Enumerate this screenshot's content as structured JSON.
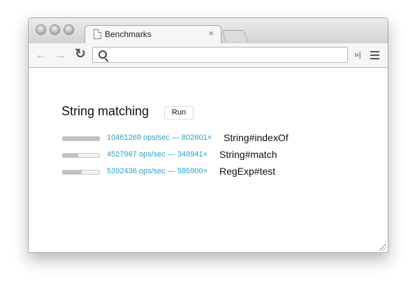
{
  "window": {
    "tab": {
      "title": "Benchmarks",
      "close": "×"
    },
    "toolbar": {
      "back": "←",
      "forward": "→",
      "reload": "↻",
      "address": {
        "value": "",
        "placeholder": ""
      },
      "extensions_chevron": "»|"
    }
  },
  "page": {
    "heading": "String matching",
    "run_label": "Run",
    "rows": [
      {
        "stats": "10461269 ops/sec — 802601×",
        "label": "String#indexOf",
        "progress": 1.0
      },
      {
        "stats": "4527967 ops/sec — 348941×",
        "label": "String#match",
        "progress": 0.43
      },
      {
        "stats": "5392436 ops/sec — 585900×",
        "label": "RegExp#test",
        "progress": 0.52
      }
    ]
  },
  "colors": {
    "stats_text": "#2aa1c9",
    "heading_text": "#111111",
    "bar_fill": "#c1c1c1"
  },
  "icons": [
    "tab-page-icon",
    "tab-close-icon",
    "back-icon",
    "forward-icon",
    "reload-icon",
    "search-icon",
    "extensions-chevron-icon",
    "menu-icon",
    "resize-grip-icon"
  ]
}
